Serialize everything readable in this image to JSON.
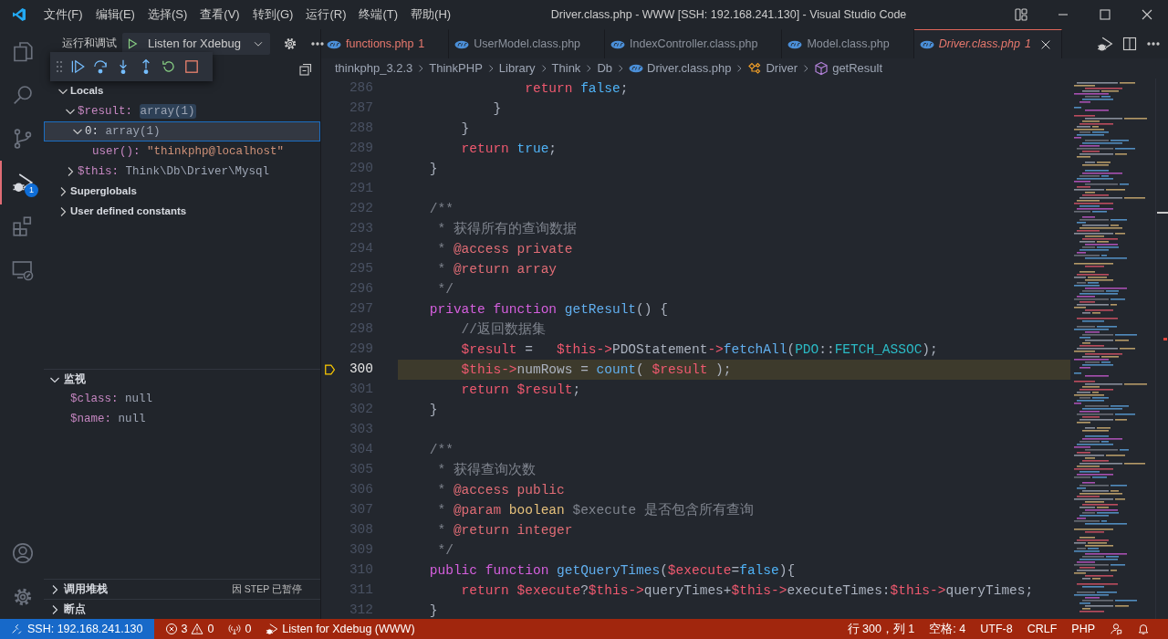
{
  "window": {
    "title": "Driver.class.php - WWW [SSH: 192.168.241.130] - Visual Studio Code"
  },
  "menu": [
    "文件(F)",
    "编辑(E)",
    "选择(S)",
    "查看(V)",
    "转到(G)",
    "运行(R)",
    "终端(T)",
    "帮助(H)"
  ],
  "activity_bar": {
    "top": [
      {
        "kind": "files",
        "selected": false
      },
      {
        "kind": "search",
        "selected": false
      },
      {
        "kind": "branch",
        "selected": false
      },
      {
        "kind": "debug",
        "selected": true,
        "badge": "1"
      },
      {
        "kind": "extensions",
        "selected": false
      },
      {
        "kind": "remote",
        "selected": false
      }
    ],
    "bottom": [
      {
        "kind": "account",
        "selected": false
      },
      {
        "kind": "gear",
        "selected": false
      }
    ]
  },
  "sidebar": {
    "title": "运行和调试",
    "launch_config": "Listen for Xdebug",
    "variables": [
      {
        "kind": "scope",
        "name": "Locals",
        "expanded": true,
        "selected": false,
        "children": [
          {
            "kind": "object",
            "name": "$result:",
            "value": "array(1)",
            "expanded": true,
            "selected": false,
            "changed": true,
            "children": [
              {
                "kind": "key",
                "name": "0:",
                "value": "array(1)",
                "expanded": true,
                "selected": true,
                "changed": false,
                "children": [
                  {
                    "kind": "string",
                    "name": "user():",
                    "value": "\"thinkphp@localhost\"",
                    "selected": false,
                    "changed": false
                  }
                ]
              }
            ]
          },
          {
            "kind": "object",
            "name": "$this:",
            "value": "Think\\Db\\Driver\\Mysql",
            "expanded": false,
            "selected": false,
            "changed": false
          }
        ]
      },
      {
        "kind": "scope",
        "name": "Superglobals",
        "expanded": false,
        "selected": false
      },
      {
        "kind": "scope",
        "name": "User defined constants",
        "expanded": false,
        "selected": false
      }
    ],
    "watch": {
      "title": "监视",
      "expanded": true,
      "items": [
        {
          "name": "$class:",
          "value": "null"
        },
        {
          "name": "$name:",
          "value": "null"
        }
      ]
    },
    "call_stack": {
      "title": "调用堆栈",
      "expanded": false,
      "status": "因 STEP 已暂停"
    },
    "breakpoints": {
      "title": "断点",
      "expanded": false
    }
  },
  "tabs": [
    {
      "label": "functions.php",
      "problems": "1",
      "error": true,
      "selected": false,
      "preview": false
    },
    {
      "label": "UserModel.class.php",
      "error": false,
      "selected": false,
      "preview": false
    },
    {
      "label": "IndexController.class.php",
      "error": false,
      "selected": false,
      "preview": false
    },
    {
      "label": "Model.class.php",
      "error": false,
      "selected": false,
      "preview": false
    },
    {
      "label": "Driver.class.php",
      "problems": "1",
      "error": true,
      "selected": true,
      "preview": true
    }
  ],
  "breadcrumb": [
    {
      "label": "thinkphp_3.2.3",
      "kind": "folder"
    },
    {
      "label": "ThinkPHP",
      "kind": "folder"
    },
    {
      "label": "Library",
      "kind": "folder"
    },
    {
      "label": "Think",
      "kind": "folder"
    },
    {
      "label": "Db",
      "kind": "folder"
    },
    {
      "label": "Driver.class.php",
      "kind": "file"
    },
    {
      "label": "Driver",
      "kind": "class"
    },
    {
      "label": "getResult",
      "kind": "method"
    }
  ],
  "editor": {
    "lines": [
      {
        "number": "286",
        "current": false,
        "tokens": [
          {
            "text": "                return ",
            "kind": "kw"
          },
          {
            "text": "false",
            "kind": "c"
          },
          {
            "text": ";",
            "kind": "p"
          }
        ]
      },
      {
        "number": "287",
        "current": false,
        "tokens": [
          {
            "text": "            }",
            "kind": "p"
          }
        ]
      },
      {
        "number": "288",
        "current": false,
        "tokens": [
          {
            "text": "        }",
            "kind": "p"
          }
        ]
      },
      {
        "number": "289",
        "current": false,
        "tokens": [
          {
            "text": "        return ",
            "kind": "kw"
          },
          {
            "text": "true",
            "kind": "c"
          },
          {
            "text": ";",
            "kind": "p"
          }
        ]
      },
      {
        "number": "290",
        "current": false,
        "tokens": [
          {
            "text": "    }",
            "kind": "p"
          }
        ]
      },
      {
        "number": "291",
        "current": false
      },
      {
        "number": "292",
        "current": false,
        "tokens": [
          {
            "text": "    /**",
            "kind": "cm"
          }
        ]
      },
      {
        "number": "293",
        "current": false,
        "tokens": [
          {
            "text": "     * 获得所有的查询数据",
            "kind": "cm"
          }
        ]
      },
      {
        "number": "294",
        "current": false,
        "tokens": [
          {
            "text": "     * ",
            "kind": "cm"
          },
          {
            "text": "@access private",
            "kind": "tag"
          }
        ]
      },
      {
        "number": "295",
        "current": false,
        "tokens": [
          {
            "text": "     * ",
            "kind": "cm"
          },
          {
            "text": "@return array",
            "kind": "tag"
          }
        ]
      },
      {
        "number": "296",
        "current": false,
        "tokens": [
          {
            "text": "     */",
            "kind": "cm"
          }
        ]
      },
      {
        "number": "297",
        "current": false,
        "tokens": [
          {
            "text": "    private function ",
            "kind": "st"
          },
          {
            "text": "getResult",
            "kind": "fn"
          },
          {
            "text": "() {",
            "kind": "p"
          }
        ]
      },
      {
        "number": "298",
        "current": false,
        "tokens": [
          {
            "text": "        //返回数据集",
            "kind": "cm"
          }
        ]
      },
      {
        "number": "299",
        "current": false,
        "tokens": [
          {
            "text": "        $result",
            "kind": "v"
          },
          {
            "text": " =   ",
            "kind": "p"
          },
          {
            "text": "$this",
            "kind": "v"
          },
          {
            "text": "->",
            "kind": "op"
          },
          {
            "text": "PDOStatement",
            "kind": "p"
          },
          {
            "text": "->",
            "kind": "op"
          },
          {
            "text": "fetchAll",
            "kind": "fn"
          },
          {
            "text": "(",
            "kind": "p"
          },
          {
            "text": "PDO",
            "kind": "cls"
          },
          {
            "text": "::",
            "kind": "p"
          },
          {
            "text": "FETCH_ASSOC",
            "kind": "cls"
          },
          {
            "text": ");",
            "kind": "p"
          }
        ]
      },
      {
        "number": "300",
        "current": true,
        "tokens": [
          {
            "text": "        $this",
            "kind": "v"
          },
          {
            "text": "->",
            "kind": "op"
          },
          {
            "text": "numRows",
            "kind": "p"
          },
          {
            "text": " = ",
            "kind": "p"
          },
          {
            "text": "count",
            "kind": "fn"
          },
          {
            "text": "( ",
            "kind": "p"
          },
          {
            "text": "$result",
            "kind": "v"
          },
          {
            "text": " );",
            "kind": "p"
          }
        ]
      },
      {
        "number": "301",
        "current": false,
        "tokens": [
          {
            "text": "        return ",
            "kind": "kw"
          },
          {
            "text": "$result",
            "kind": "v"
          },
          {
            "text": ";",
            "kind": "p"
          }
        ]
      },
      {
        "number": "302",
        "current": false,
        "tokens": [
          {
            "text": "    }",
            "kind": "p"
          }
        ]
      },
      {
        "number": "303",
        "current": false
      },
      {
        "number": "304",
        "current": false,
        "tokens": [
          {
            "text": "    /**",
            "kind": "cm"
          }
        ]
      },
      {
        "number": "305",
        "current": false,
        "tokens": [
          {
            "text": "     * 获得查询次数",
            "kind": "cm"
          }
        ]
      },
      {
        "number": "306",
        "current": false,
        "tokens": [
          {
            "text": "     * ",
            "kind": "cm"
          },
          {
            "text": "@access public",
            "kind": "tag"
          }
        ]
      },
      {
        "number": "307",
        "current": false,
        "tokens": [
          {
            "text": "     * ",
            "kind": "cm"
          },
          {
            "text": "@param ",
            "kind": "tag"
          },
          {
            "text": "boolean",
            "kind": "ty"
          },
          {
            "text": " $execute 是否包含所有查询",
            "kind": "cm"
          }
        ]
      },
      {
        "number": "308",
        "current": false,
        "tokens": [
          {
            "text": "     * ",
            "kind": "cm"
          },
          {
            "text": "@return integer",
            "kind": "tag"
          }
        ]
      },
      {
        "number": "309",
        "current": false,
        "tokens": [
          {
            "text": "     */",
            "kind": "cm"
          }
        ]
      },
      {
        "number": "310",
        "current": false,
        "tokens": [
          {
            "text": "    public function ",
            "kind": "st"
          },
          {
            "text": "getQueryTimes",
            "kind": "fn"
          },
          {
            "text": "(",
            "kind": "p"
          },
          {
            "text": "$execute",
            "kind": "v"
          },
          {
            "text": "=",
            "kind": "p"
          },
          {
            "text": "false",
            "kind": "c"
          },
          {
            "text": "){",
            "kind": "p"
          }
        ]
      },
      {
        "number": "311",
        "current": false,
        "tokens": [
          {
            "text": "        return ",
            "kind": "kw"
          },
          {
            "text": "$execute",
            "kind": "v"
          },
          {
            "text": "?",
            "kind": "p"
          },
          {
            "text": "$this",
            "kind": "v"
          },
          {
            "text": "->",
            "kind": "op"
          },
          {
            "text": "queryTimes",
            "kind": "p"
          },
          {
            "text": "+",
            "kind": "p"
          },
          {
            "text": "$this",
            "kind": "v"
          },
          {
            "text": "->",
            "kind": "op"
          },
          {
            "text": "executeTimes",
            "kind": "p"
          },
          {
            "text": ":",
            "kind": "p"
          },
          {
            "text": "$this",
            "kind": "v"
          },
          {
            "text": "->",
            "kind": "op"
          },
          {
            "text": "queryTimes",
            "kind": "p"
          },
          {
            "text": ";",
            "kind": "p"
          }
        ]
      },
      {
        "number": "312",
        "current": false,
        "tokens": [
          {
            "text": "    }",
            "kind": "p"
          }
        ]
      }
    ]
  },
  "status_bar": {
    "left": [
      {
        "kind": "remote",
        "text": "SSH: 192.168.241.130"
      },
      {
        "kind": "problems",
        "errors": "3",
        "warnings": "0"
      },
      {
        "kind": "ports",
        "text": "0"
      },
      {
        "kind": "debug",
        "text": "Listen for Xdebug (WWW)"
      }
    ],
    "right": [
      {
        "kind": "text",
        "text": "行 300，列 1"
      },
      {
        "kind": "text",
        "text": "空格: 4"
      },
      {
        "kind": "text",
        "text": "UTF-8"
      },
      {
        "kind": "text",
        "text": "CRLF"
      },
      {
        "kind": "text",
        "text": "PHP"
      },
      {
        "kind": "feedback"
      },
      {
        "kind": "bell"
      }
    ]
  }
}
